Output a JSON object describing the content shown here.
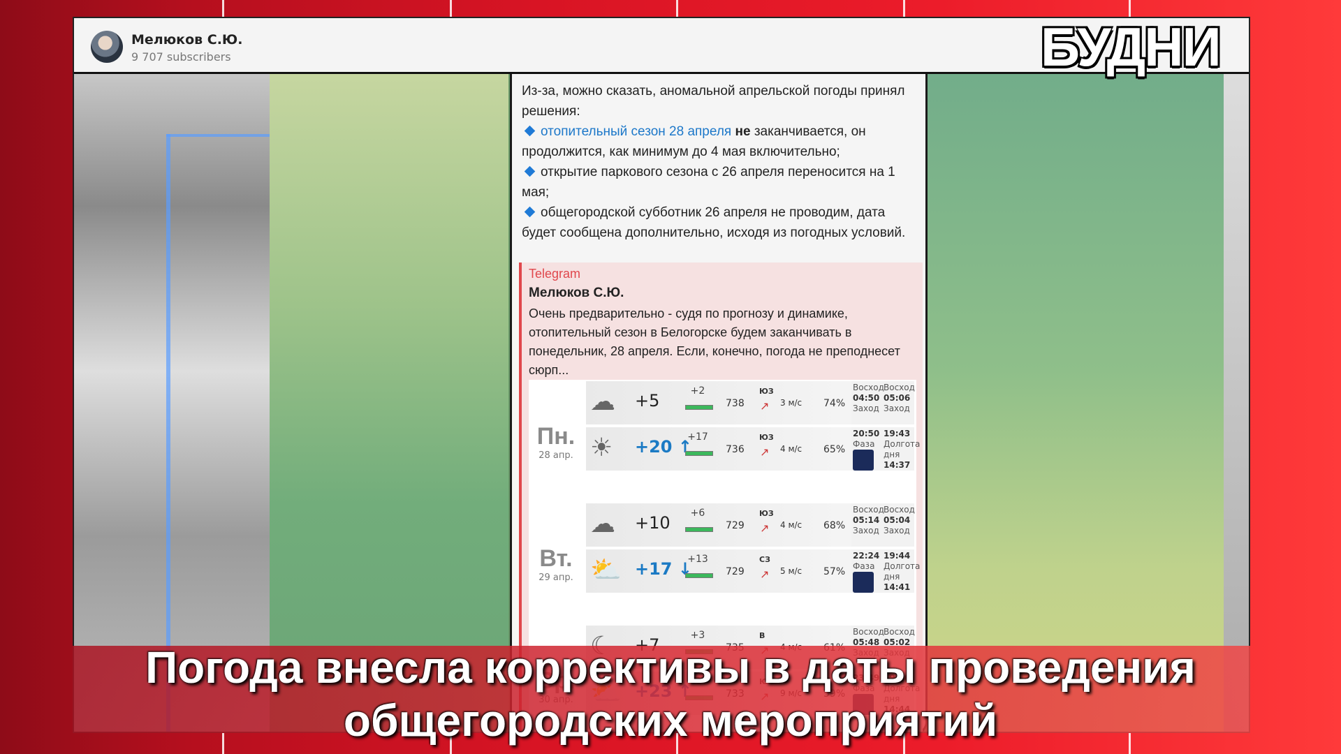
{
  "logo": "БУДНИ",
  "channel": {
    "name": "Мелюков С.Ю.",
    "subscribers": "9 707 subscribers"
  },
  "message": {
    "intro": "Из-за, можно сказать, аномальной апрельской погоды принял решения:",
    "item1_link": "отопительный сезон 28 апреля",
    "item1_bold": "не",
    "item1_rest": "заканчивается, он продолжится, как минимум до 4 мая включительно;",
    "item2": "открытие паркового сезона с 26 апреля переносится на 1 мая;",
    "item3": "общегородской субботник 26 апреля не проводим, дата будет сообщена дополнительно, исходя из погодных условий."
  },
  "quote": {
    "source": "Telegram",
    "author": "Мелюков С.Ю.",
    "text": "Очень предварительно - судя по прогнозу и динамике, отопительный сезон в Белогорске будем заканчивать в понедельник, 28 апреля. Если, конечно, погода не преподнесет сюрп..."
  },
  "forecast": {
    "days": [
      {
        "name": "Пн.",
        "date": "28 апр.",
        "rows": [
          {
            "icon": "night-cloudy-icon",
            "glyph": "☁",
            "temp": "+5",
            "feel": "+2",
            "press": "738",
            "dir": "ЮЗ",
            "wind": "3 м/с",
            "hum": "74%"
          },
          {
            "icon": "sun-cloud-icon",
            "glyph": "☀",
            "temp": "+20",
            "trend": "↑",
            "feel": "+17",
            "press": "736",
            "dir": "ЮЗ",
            "wind": "4 м/с",
            "hum": "65%"
          }
        ],
        "sun": {
          "rise1": "04:50",
          "set1": "20:50",
          "rise2": "05:06",
          "set2": "19:43",
          "daylen": "14:37"
        }
      },
      {
        "name": "Вт.",
        "date": "29 апр.",
        "rows": [
          {
            "icon": "night-cloudy-icon",
            "glyph": "☁",
            "temp": "+10",
            "feel": "+6",
            "press": "729",
            "dir": "ЮЗ",
            "wind": "4 м/с",
            "hum": "68%"
          },
          {
            "icon": "sun-cloud-icon",
            "glyph": "⛅",
            "temp": "+17",
            "trend": "↓",
            "feel": "+13",
            "press": "729",
            "dir": "СЗ",
            "wind": "5 м/с",
            "hum": "57%"
          }
        ],
        "sun": {
          "rise1": "05:14",
          "set1": "22:24",
          "rise2": "05:04",
          "set2": "19:44",
          "daylen": "14:41"
        }
      },
      {
        "name": "Ср.",
        "date": "30 апр.",
        "rows": [
          {
            "icon": "moon-cloud-icon",
            "glyph": "☾",
            "temp": "+7",
            "feel": "+3",
            "press": "735",
            "dir": "В",
            "wind": "4 м/с",
            "hum": "61%"
          },
          {
            "icon": "sun-cloud-icon",
            "glyph": "⛅",
            "temp": "+23",
            "trend": "↑",
            "feel": "+17",
            "press": "733",
            "dir": "Ю",
            "wind": "9 м/с",
            "hum": "59%"
          }
        ],
        "sun": {
          "rise1": "05:48",
          "set1": "23:49",
          "rise2": "05:02",
          "set2": "19:46",
          "daylen": "14:44"
        }
      }
    ],
    "labels": {
      "rise": "Восход",
      "set": "Заход",
      "phase": "Фаза",
      "daylen": "Долгота дня"
    }
  },
  "caption": {
    "line1": "Погода внесла коррективы в даты проведения",
    "line2": "общегородских мероприятий"
  }
}
